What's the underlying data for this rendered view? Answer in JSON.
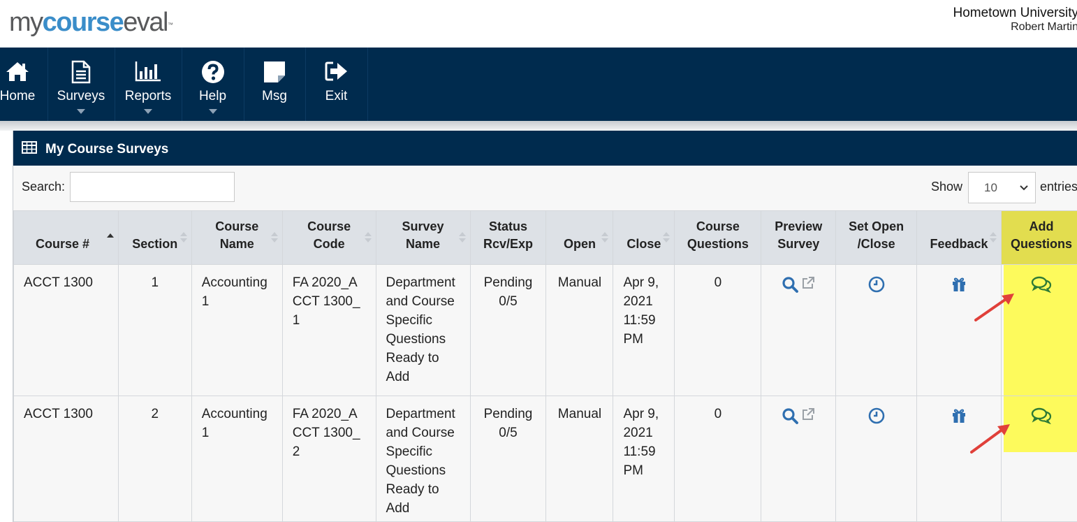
{
  "header": {
    "logo": {
      "part1": "my",
      "part2": "course",
      "part3": "eval",
      "tm": "™"
    },
    "institution": "Hometown University",
    "user": "Robert Martin"
  },
  "nav": {
    "items": [
      {
        "label": "Home",
        "icon": "home-icon"
      },
      {
        "label": "Surveys",
        "icon": "document-icon",
        "dropdown": true
      },
      {
        "label": "Reports",
        "icon": "bar-chart-icon",
        "dropdown": true
      },
      {
        "label": "Help",
        "icon": "help-icon",
        "dropdown": true
      },
      {
        "label": "Msg",
        "icon": "note-icon"
      },
      {
        "label": "Exit",
        "icon": "exit-icon"
      }
    ]
  },
  "panel": {
    "title": "My Course Surveys",
    "search_label": "Search:",
    "search_value": "",
    "show_label": "Show",
    "entries_value": "10",
    "entries_label": "entries"
  },
  "table": {
    "columns": [
      {
        "line1": "Course #",
        "line2": ""
      },
      {
        "line1": "Section",
        "line2": ""
      },
      {
        "line1": "Course",
        "line2": "Name"
      },
      {
        "line1": "Course",
        "line2": "Code"
      },
      {
        "line1": "Survey",
        "line2": "Name"
      },
      {
        "line1": "Status",
        "line2": "Rcv/Exp"
      },
      {
        "line1": "Open",
        "line2": ""
      },
      {
        "line1": "Close",
        "line2": ""
      },
      {
        "line1": "Course",
        "line2": "Questions"
      },
      {
        "line1": "Preview",
        "line2": "Survey"
      },
      {
        "line1": "Set Open",
        "line2": "/Close"
      },
      {
        "line1": "Feedback",
        "line2": ""
      },
      {
        "line1": "Add",
        "line2": "Questions"
      }
    ],
    "rows": [
      {
        "course_num": "ACCT 1300",
        "section": "1",
        "course_name": "Accounting 1",
        "course_code": "FA 2020_ACCT 1300_1",
        "survey_name": "Department and Course Specific Questions Ready to Add",
        "status": "Pending 0/5",
        "open": "Manual",
        "close": "Apr 9, 2021 11:59 PM",
        "course_questions": "0"
      },
      {
        "course_num": "ACCT 1300",
        "section": "2",
        "course_name": "Accounting 1",
        "course_code": "FA 2020_ACCT 1300_2",
        "survey_name": "Department and Course Specific Questions Ready to Add",
        "status": "Pending 0/5",
        "open": "Manual",
        "close": "Apr 9, 2021 11:59 PM",
        "course_questions": "0"
      }
    ]
  },
  "colors": {
    "nav_bg": "#002b4e",
    "accent_blue": "#2f6fb0",
    "highlight": "#fdfa5c",
    "arrow": "#e0403a",
    "chat_icon": "#2e7a36"
  }
}
